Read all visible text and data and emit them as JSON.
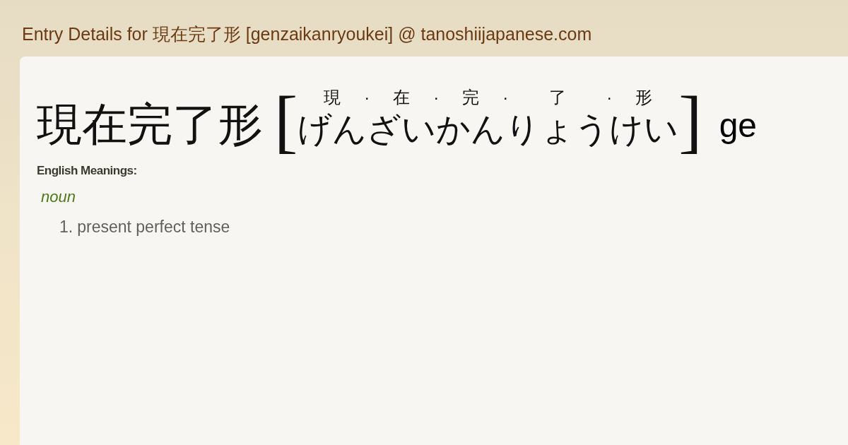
{
  "page_title": "Entry Details for 現在完了形 [genzaikanryoukei] @ tanoshiijapanese.com",
  "entry": {
    "headword": "現在完了形",
    "open_bracket": "[",
    "close_bracket": "]",
    "romaji": "ge",
    "readings": [
      {
        "kanji": "現",
        "kana": "げん"
      },
      {
        "separator": "·"
      },
      {
        "kanji": "在",
        "kana": "ざい"
      },
      {
        "separator": "·"
      },
      {
        "kanji": "完",
        "kana": "かん"
      },
      {
        "separator": "·"
      },
      {
        "kanji": "了",
        "kana": "りょう"
      },
      {
        "separator": "·"
      },
      {
        "kanji": "形",
        "kana": "けい"
      }
    ]
  },
  "meanings": {
    "heading": "English Meanings:",
    "part_of_speech": "noun",
    "senses": [
      {
        "number": "1.",
        "text": "present perfect tense"
      }
    ]
  }
}
